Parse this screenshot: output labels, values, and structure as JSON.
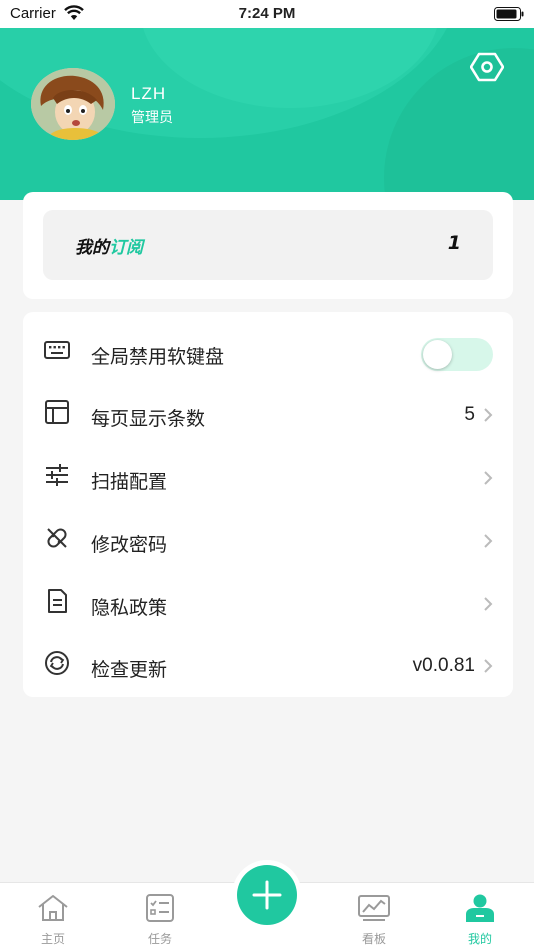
{
  "status_bar": {
    "carrier": "Carrier",
    "time": "7:24 PM"
  },
  "profile": {
    "name": "LZH",
    "role": "管理员"
  },
  "subscription": {
    "label_prefix": "我的",
    "label_accent": "订阅",
    "count": "1"
  },
  "settings": [
    {
      "icon": "keyboard-icon",
      "label": "全局禁用软键盘",
      "type": "toggle",
      "toggle_on": false
    },
    {
      "icon": "layout-icon",
      "label": "每页显示条数",
      "value": "5",
      "type": "link"
    },
    {
      "icon": "sliders-icon",
      "label": "扫描配置",
      "type": "link"
    },
    {
      "icon": "password-icon",
      "label": "修改密码",
      "type": "link"
    },
    {
      "icon": "document-icon",
      "label": "隐私政策",
      "type": "link"
    },
    {
      "icon": "refresh-icon",
      "label": "检查更新",
      "value": "v0.0.81",
      "type": "link"
    }
  ],
  "tabs": [
    {
      "label": "主页",
      "icon": "home-icon",
      "active": false
    },
    {
      "label": "任务",
      "icon": "task-icon",
      "active": false
    },
    {
      "label": "看板",
      "icon": "dashboard-icon",
      "active": false
    },
    {
      "label": "我的",
      "icon": "user-icon",
      "active": true
    }
  ],
  "colors": {
    "accent": "#20c8a0",
    "tab_inactive": "#9a9a9a",
    "background": "#f5f5f5"
  }
}
